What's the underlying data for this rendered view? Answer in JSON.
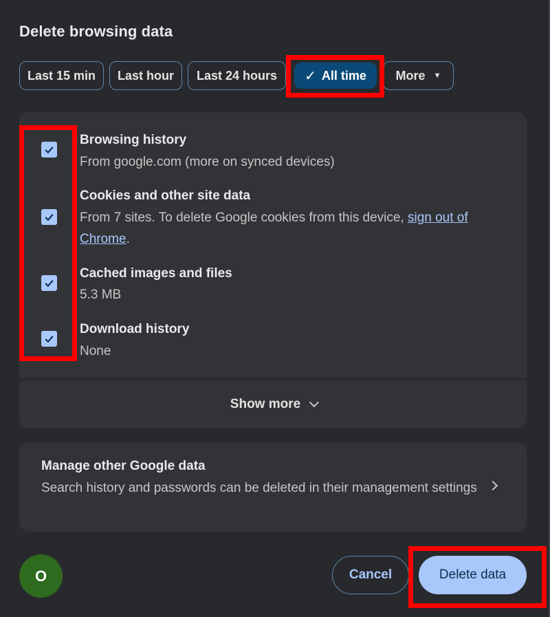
{
  "dialog": {
    "title": "Delete browsing data"
  },
  "time_range": {
    "options": [
      {
        "label": "Last 15 min",
        "selected": false
      },
      {
        "label": "Last hour",
        "selected": false
      },
      {
        "label": "Last 24 hours",
        "selected": false
      },
      {
        "label": "All time",
        "selected": true
      },
      {
        "label": "More",
        "selected": false
      }
    ],
    "check_glyph": "✓",
    "more_caret": "▼"
  },
  "items": [
    {
      "title": "Browsing history",
      "desc": "From google.com (more on synced devices)",
      "checked": true
    },
    {
      "title": "Cookies and other site data",
      "desc": "From 7 sites. To delete Google cookies from this device, ",
      "link": "sign out of Chrome",
      "desc_end": ".",
      "checked": true
    },
    {
      "title": "Cached images and files",
      "desc": "5.3 MB",
      "checked": true
    },
    {
      "title": "Download history",
      "desc": "None",
      "checked": true
    }
  ],
  "show_more": {
    "label": "Show more"
  },
  "manage": {
    "title": "Manage other Google data",
    "desc": "Search history and passwords can be deleted in their management settings"
  },
  "footer": {
    "avatar_initial": "O",
    "cancel_label": "Cancel",
    "delete_label": "Delete data"
  },
  "colors": {
    "accent": "#a8c7fa",
    "selected_chip": "#0b4a78",
    "highlight": "#ff0000",
    "avatar": "#2e6b1f"
  }
}
